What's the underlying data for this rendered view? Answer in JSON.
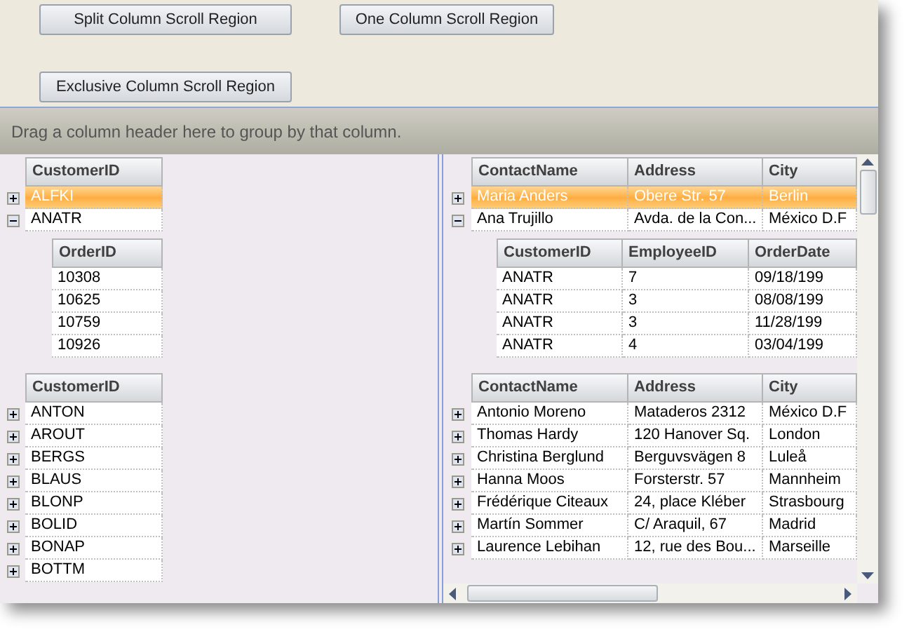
{
  "buttons": [
    {
      "label": "Split Column Scroll Region"
    },
    {
      "label": "One Column Scroll Region"
    },
    {
      "label": "Exclusive Column Scroll Region"
    }
  ],
  "group_by_prompt": "Drag a column header here to group by that column.",
  "left_region": {
    "bands": [
      {
        "columns": [
          "CustomerID"
        ],
        "rows": [
          {
            "cells": [
              "ALFKI"
            ],
            "selected": true,
            "expanded": false
          },
          {
            "cells": [
              "ANATR"
            ],
            "selected": false,
            "expanded": true,
            "children": {
              "columns": [
                "OrderID"
              ],
              "rows": [
                {
                  "cells": [
                    "10308"
                  ]
                },
                {
                  "cells": [
                    "10625"
                  ]
                },
                {
                  "cells": [
                    "10759"
                  ]
                },
                {
                  "cells": [
                    "10926"
                  ]
                }
              ]
            }
          }
        ]
      },
      {
        "columns": [
          "CustomerID"
        ],
        "rows": [
          {
            "cells": [
              "ANTON"
            ],
            "selected": false,
            "expanded": false
          },
          {
            "cells": [
              "AROUT"
            ],
            "selected": false,
            "expanded": false
          },
          {
            "cells": [
              "BERGS"
            ],
            "selected": false,
            "expanded": false
          },
          {
            "cells": [
              "BLAUS"
            ],
            "selected": false,
            "expanded": false
          },
          {
            "cells": [
              "BLONP"
            ],
            "selected": false,
            "expanded": false
          },
          {
            "cells": [
              "BOLID"
            ],
            "selected": false,
            "expanded": false
          },
          {
            "cells": [
              "BONAP"
            ],
            "selected": false,
            "expanded": false
          },
          {
            "cells": [
              "BOTTM"
            ],
            "selected": false,
            "expanded": false
          }
        ]
      }
    ]
  },
  "right_region": {
    "bands": [
      {
        "columns": [
          "ContactName",
          "Address",
          "City"
        ],
        "rows": [
          {
            "cells": [
              "Maria Anders",
              "Obere Str. 57",
              "Berlin"
            ],
            "selected": true,
            "expanded": false
          },
          {
            "cells": [
              "Ana Trujillo",
              "Avda. de la Con...",
              "México D.F"
            ],
            "selected": false,
            "expanded": true,
            "children": {
              "columns": [
                "CustomerID",
                "EmployeeID",
                "OrderDate"
              ],
              "rows": [
                {
                  "cells": [
                    "ANATR",
                    "7",
                    "09/18/199"
                  ]
                },
                {
                  "cells": [
                    "ANATR",
                    "3",
                    "08/08/199"
                  ]
                },
                {
                  "cells": [
                    "ANATR",
                    "3",
                    "11/28/199"
                  ]
                },
                {
                  "cells": [
                    "ANATR",
                    "4",
                    "03/04/199"
                  ]
                }
              ]
            }
          }
        ]
      },
      {
        "columns": [
          "ContactName",
          "Address",
          "City"
        ],
        "rows": [
          {
            "cells": [
              "Antonio Moreno",
              "Mataderos  2312",
              "México D.F"
            ],
            "selected": false,
            "expanded": false
          },
          {
            "cells": [
              "Thomas Hardy",
              "120 Hanover Sq.",
              "London"
            ],
            "selected": false,
            "expanded": false
          },
          {
            "cells": [
              "Christina Berglund",
              "Berguvsvägen  8",
              "Luleå"
            ],
            "selected": false,
            "expanded": false
          },
          {
            "cells": [
              "Hanna Moos",
              "Forsterstr. 57",
              "Mannheim"
            ],
            "selected": false,
            "expanded": false
          },
          {
            "cells": [
              "Frédérique Citeaux",
              "24, place Kléber",
              "Strasbourg"
            ],
            "selected": false,
            "expanded": false
          },
          {
            "cells": [
              "Martín Sommer",
              "C/ Araquil, 67",
              "Madrid"
            ],
            "selected": false,
            "expanded": false
          },
          {
            "cells": [
              "Laurence Lebihan",
              "12, rue des Bou...",
              "Marseille"
            ],
            "selected": false,
            "expanded": false
          }
        ]
      }
    ]
  }
}
